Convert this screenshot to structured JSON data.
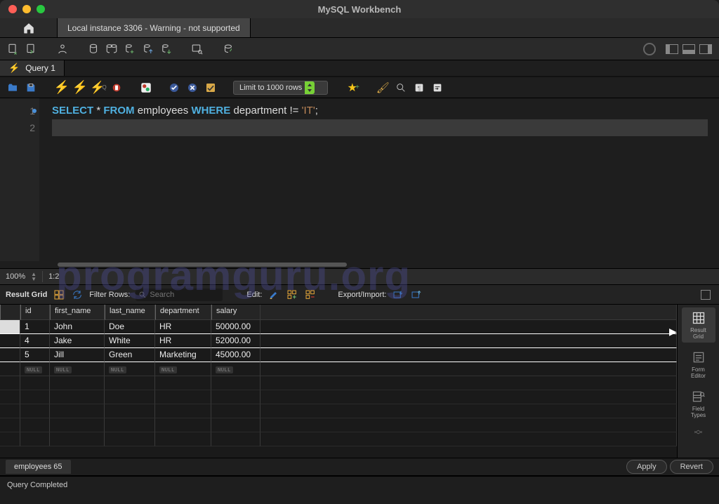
{
  "app_title": "MySQL Workbench",
  "connection_tab": "Local instance 3306 - Warning - not supported",
  "query_tab": {
    "label": "Query 1"
  },
  "query_toolbar": {
    "limit_label": "Limit to 1000 rows"
  },
  "editor": {
    "lines": [
      "1",
      "2"
    ],
    "sql": {
      "select": "SELECT",
      "star": "*",
      "from": "FROM",
      "table": "employees",
      "where": "WHERE",
      "column": "department",
      "op": "!=",
      "value": "'IT'",
      "semi": ";"
    }
  },
  "watermark": "programguru.org",
  "zoom": {
    "percent": "100%",
    "cursor": "1:2"
  },
  "result_toolbar": {
    "grid_label": "Result Grid",
    "filter_label": "Filter Rows:",
    "search_placeholder": "Search",
    "edit_label": "Edit:",
    "export_label": "Export/Import:"
  },
  "grid": {
    "columns": [
      "id",
      "first_name",
      "last_name",
      "department",
      "salary"
    ],
    "rows": [
      {
        "id": "1",
        "first_name": "John",
        "last_name": "Doe",
        "department": "HR",
        "salary": "50000.00"
      },
      {
        "id": "4",
        "first_name": "Jake",
        "last_name": "White",
        "department": "HR",
        "salary": "52000.00"
      },
      {
        "id": "5",
        "first_name": "Jill",
        "last_name": "Green",
        "department": "Marketing",
        "salary": "45000.00"
      }
    ],
    "null_placeholder": "NULL"
  },
  "side_tabs": {
    "result_grid": "Result\nGrid",
    "form_editor": "Form\nEditor",
    "field_types": "Field\nTypes"
  },
  "result_set_tab": "employees 65",
  "buttons": {
    "apply": "Apply",
    "revert": "Revert"
  },
  "status": "Query Completed"
}
